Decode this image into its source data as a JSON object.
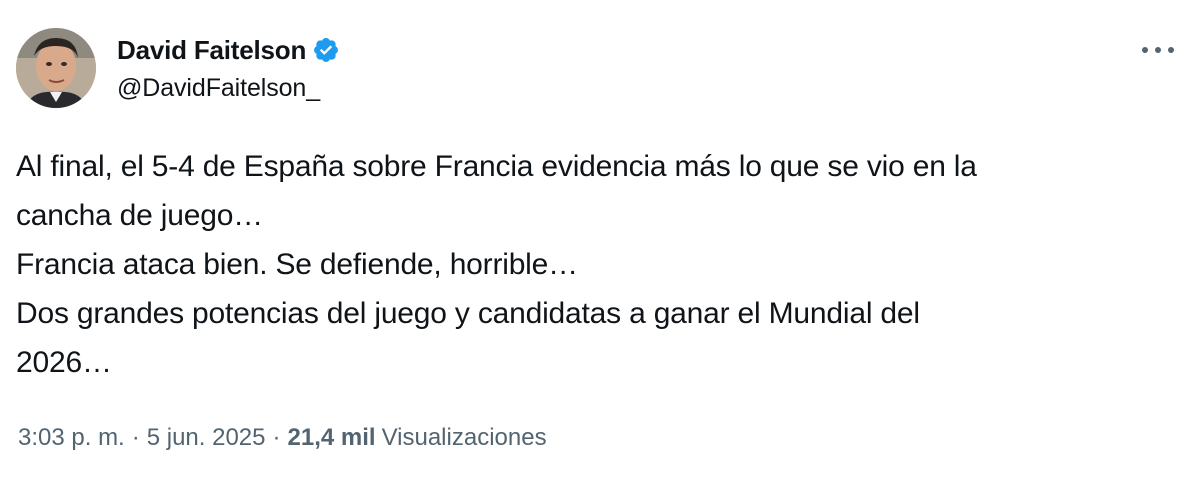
{
  "author": {
    "display_name": "David Faitelson",
    "handle": "@DavidFaitelson_",
    "verified": true,
    "avatar_icon": "profile-photo",
    "verified_icon": "verified-badge-icon",
    "verified_color": "#1d9bf0"
  },
  "menu": {
    "icon": "more-options-icon"
  },
  "tweet": {
    "lines": [
      "Al final, el 5-4 de España sobre Francia evidencia más lo que se vio en la",
      "cancha de juego…",
      "Francia ataca bien. Se defiende, horrible…",
      "Dos grandes potencias del juego y candidatas a ganar el Mundial del",
      "2026…"
    ]
  },
  "meta": {
    "time": "3:03 p. m.",
    "separator": "·",
    "date": "5 jun. 2025",
    "views_count": "21,4 mil",
    "views_label": "Visualizaciones"
  },
  "colors": {
    "text_primary": "#0f1419",
    "text_secondary": "#536471",
    "background": "#ffffff"
  }
}
